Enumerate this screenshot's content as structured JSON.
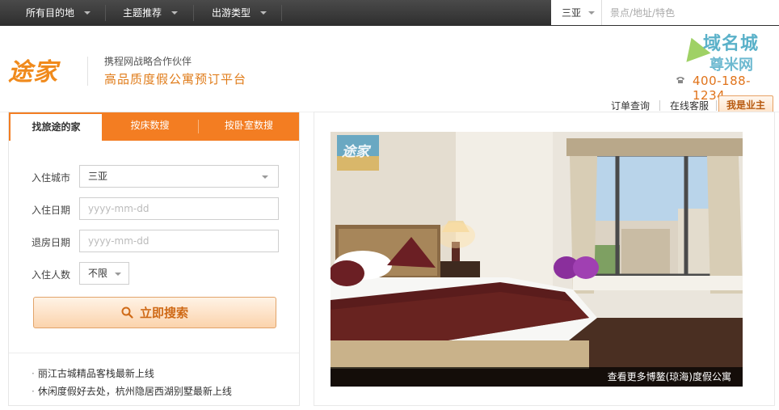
{
  "topnav": {
    "items": [
      {
        "label": "所有目的地"
      },
      {
        "label": "主题推荐"
      },
      {
        "label": "出游类型"
      }
    ],
    "city": "三亚",
    "search_placeholder": "景点/地址/特色"
  },
  "header": {
    "logo_text": "途家",
    "partner": "携程网战略合作伙伴",
    "tagline": "高品质度假公寓预订平台",
    "watermark_top": "域名城",
    "watermark_bottom": "尊米网",
    "phone": "400-188-1234",
    "links": {
      "order": "订单查询",
      "service": "在线客服",
      "owner": "我是业主"
    }
  },
  "search_panel": {
    "tabs": [
      {
        "label": "找旅途的家"
      },
      {
        "label": "按床数搜"
      },
      {
        "label": "按卧室数搜"
      }
    ],
    "fields": {
      "city_label": "入住城市",
      "city_value": "三亚",
      "checkin_label": "入住日期",
      "checkin_placeholder": "yyyy-mm-dd",
      "checkout_label": "退房日期",
      "checkout_placeholder": "yyyy-mm-dd",
      "guests_label": "入住人数",
      "guests_value": "不限"
    },
    "search_button": "立即搜索",
    "news": [
      "丽江古城精品客栈最新上线",
      "休闲度假好去处，杭州隐居西湖别墅最新上线"
    ]
  },
  "promo": {
    "logo_text": "途家",
    "caption": "查看更多博鳌(琼海)度假公寓"
  },
  "colors": {
    "brand_orange": "#f37d22",
    "topbar": "#333333",
    "accent_text": "#e07c1a"
  }
}
